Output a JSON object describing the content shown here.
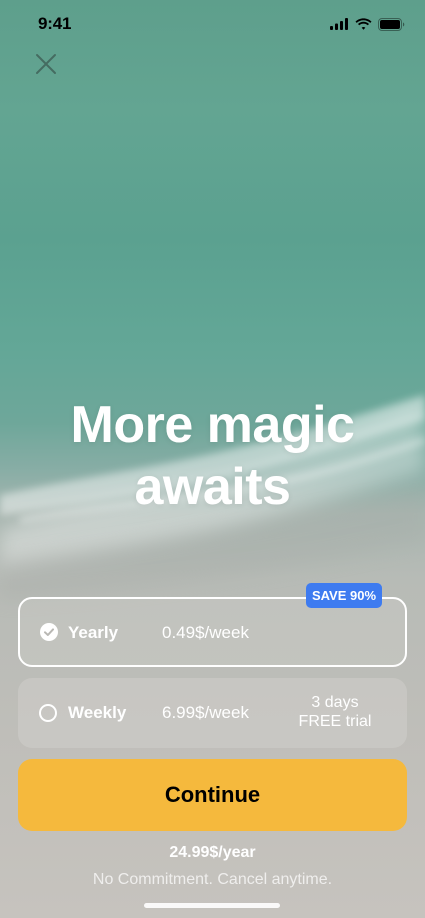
{
  "status_bar": {
    "time": "9:41",
    "icons": [
      "signal-icon",
      "wifi-icon",
      "battery-icon"
    ]
  },
  "close_icon": "close-icon",
  "headline": "More magic awaits",
  "badge": {
    "label": "SAVE 90%",
    "color": "#3e7bf0"
  },
  "plans": [
    {
      "name": "Yearly",
      "price": "0.49$/week",
      "selected": true,
      "radio_icon": "check-circle-icon"
    },
    {
      "name": "Weekly",
      "price": "6.99$/week",
      "trial": "3 days FREE trial",
      "selected": false,
      "radio_icon": "radio-empty-icon"
    }
  ],
  "continue_button": {
    "label": "Continue",
    "color": "#f5b93d"
  },
  "summary": "24.99$/year",
  "note": "No Commitment. Cancel anytime."
}
